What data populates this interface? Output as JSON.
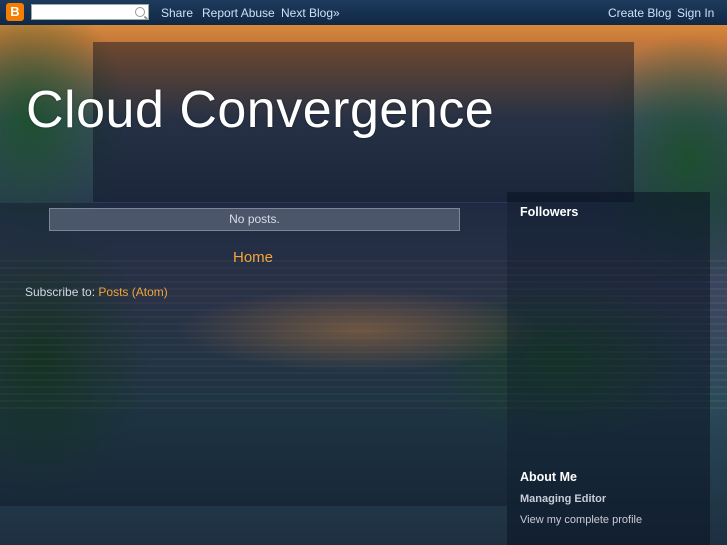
{
  "navbar": {
    "logo_letter": "B",
    "search": {
      "value": "",
      "placeholder": ""
    },
    "links": [
      "Share",
      "Report Abuse",
      "Next Blog»"
    ],
    "create_blog": "Create Blog",
    "sign_in": "Sign In"
  },
  "blog": {
    "title": "Cloud Convergence",
    "no_posts": "No posts.",
    "home_link": "Home",
    "subscribe_label": "Subscribe to:",
    "subscribe_link": "Posts (Atom)"
  },
  "sidebar": {
    "followers_heading": "Followers",
    "about_heading": "About Me",
    "profile_name": "Managing Editor",
    "profile_link": "View my complete profile"
  },
  "colors": {
    "link_accent": "#f3a53a",
    "navbar": "#1e3a5c"
  }
}
